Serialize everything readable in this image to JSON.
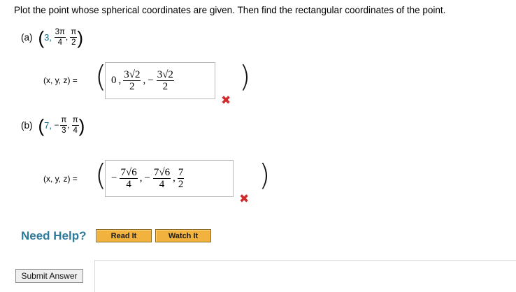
{
  "question": {
    "prompt": "Plot the point whose spherical coordinates are given. Then find the rectangular coordinates of the point."
  },
  "parts": [
    {
      "label": "(a)",
      "given": {
        "r": "3",
        "theta_num": "3π",
        "theta_den": "4",
        "phi_num": "π",
        "phi_den": "2"
      },
      "answer_label": "(x, y, z) =",
      "answer": {
        "x": "0",
        "y_sign": "",
        "y_num": "3√2",
        "y_den": "2",
        "z_sign": "−",
        "z_num": "3√2",
        "z_den": "2"
      },
      "status": "incorrect"
    },
    {
      "label": "(b)",
      "given": {
        "r": "7",
        "theta_sign": "−",
        "theta_num": "π",
        "theta_den": "3",
        "phi_num": "π",
        "phi_den": "4"
      },
      "answer_label": "(x, y, z) =",
      "answer": {
        "x_sign": "−",
        "x_num": "7√6",
        "x_den": "4",
        "y_sign": "−",
        "y_num": "7√6",
        "y_den": "4",
        "z_num": "7",
        "z_den": "2"
      },
      "status": "incorrect"
    }
  ],
  "help": {
    "label": "Need Help?",
    "read_it": "Read It",
    "watch_it": "Watch It"
  },
  "submit": {
    "label": "Submit Answer"
  },
  "colors": {
    "help_text": "#2d7a9a",
    "incorrect": "#d12a2a",
    "button_orange": "#f2b23e"
  },
  "icons": {
    "incorrect_mark": "x-mark-icon"
  }
}
